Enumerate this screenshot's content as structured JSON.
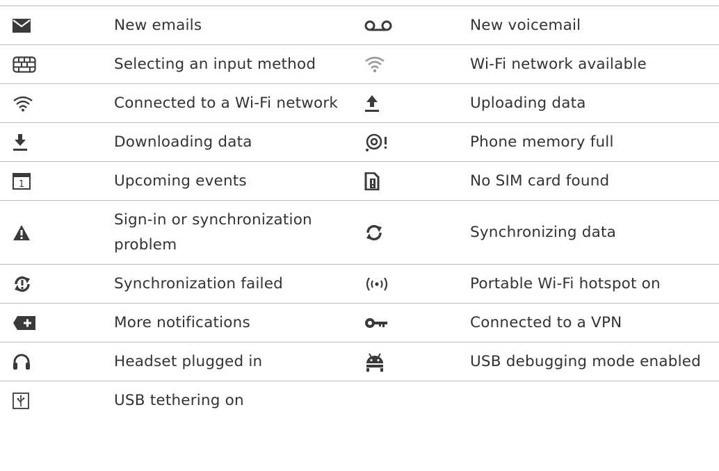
{
  "rows": [
    {
      "left": {
        "icon": "envelope-icon",
        "label": "New emails"
      },
      "right": {
        "icon": "voicemail-icon",
        "label": "New voicemail"
      }
    },
    {
      "left": {
        "icon": "keyboard-icon",
        "label": "Selecting an input method"
      },
      "right": {
        "icon": "wifi-available-icon",
        "label": "Wi-Fi network available"
      }
    },
    {
      "left": {
        "icon": "wifi-connected-icon",
        "label": "Connected to a Wi-Fi network"
      },
      "right": {
        "icon": "upload-icon",
        "label": "Uploading data"
      }
    },
    {
      "left": {
        "icon": "download-icon",
        "label": "Downloading data"
      },
      "right": {
        "icon": "memory-full-icon",
        "label": "Phone memory full"
      }
    },
    {
      "left": {
        "icon": "calendar-icon",
        "label": "Upcoming events",
        "calendar_day": "1"
      },
      "right": {
        "icon": "no-sim-icon",
        "label": "No SIM card found"
      }
    },
    {
      "left": {
        "icon": "warning-icon",
        "label": "Sign-in or synchronization problem"
      },
      "right": {
        "icon": "sync-icon",
        "label": "Synchronizing data"
      }
    },
    {
      "left": {
        "icon": "sync-failed-icon",
        "label": "Synchronization failed"
      },
      "right": {
        "icon": "hotspot-icon",
        "label": "Portable Wi-Fi hotspot on"
      }
    },
    {
      "left": {
        "icon": "more-notifications-icon",
        "label": "More notifications"
      },
      "right": {
        "icon": "vpn-key-icon",
        "label": "Connected to a VPN"
      }
    },
    {
      "left": {
        "icon": "headset-icon",
        "label": "Headset plugged in"
      },
      "right": {
        "icon": "android-debug-icon",
        "label": "USB debugging mode enabled"
      }
    },
    {
      "left": {
        "icon": "usb-tethering-icon",
        "label": "USB tethering on"
      },
      "right": null
    }
  ]
}
